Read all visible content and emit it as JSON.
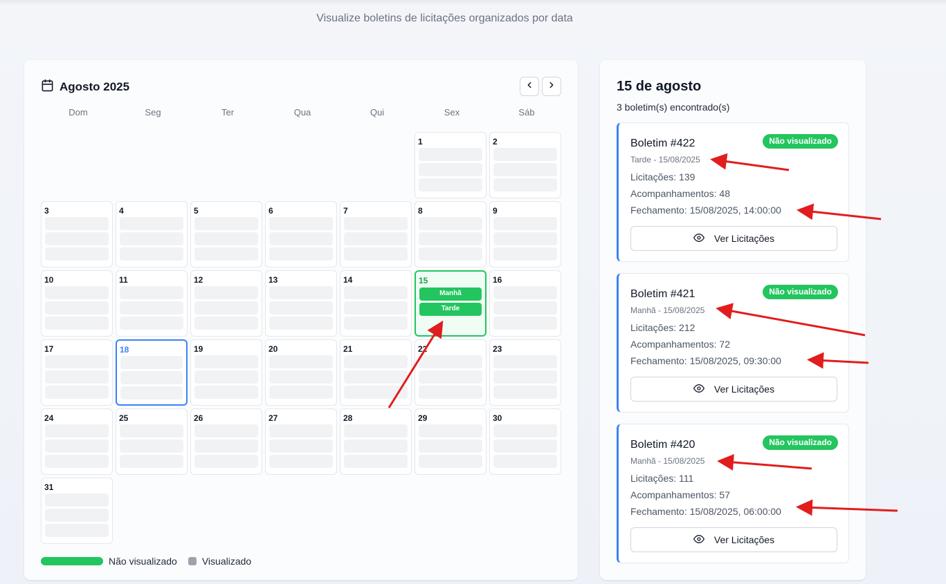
{
  "page": {
    "subtitle": "Visualize boletins de licitações organizados por data"
  },
  "calendar": {
    "month_label": "Agosto 2025",
    "icon": "calendar-icon",
    "prev_icon": "chevron-left-icon",
    "next_icon": "chevron-right-icon",
    "weekdays": [
      "Dom",
      "Seg",
      "Ter",
      "Qua",
      "Qui",
      "Sex",
      "Sáb"
    ],
    "days": [
      "1",
      "2",
      "3",
      "4",
      "5",
      "6",
      "7",
      "8",
      "9",
      "10",
      "11",
      "12",
      "13",
      "14",
      "15",
      "16",
      "17",
      "18",
      "19",
      "20",
      "21",
      "22",
      "23",
      "24",
      "25",
      "26",
      "27",
      "28",
      "29",
      "30",
      "31"
    ],
    "today": "18",
    "selected": "15",
    "selected_chips": [
      "Manhã",
      "Tarde"
    ],
    "legend": {
      "unviewed": "Não visualizado",
      "viewed": "Visualizado",
      "unviewed_color": "#22c55e",
      "viewed_color": "#9ca3af"
    }
  },
  "panel": {
    "title": "15 de agosto",
    "count": "3 boletim(s) encontrado(s)",
    "bulletins": [
      {
        "title": "Boletim #422",
        "badge": "Não visualizado",
        "subtitle": "Tarde - 15/08/2025",
        "licitacoes": "Licitações: 139",
        "acompanhamentos": "Acompanhamentos: 48",
        "fechamento": "Fechamento: 15/08/2025, 14:00:00",
        "button": "Ver Licitações"
      },
      {
        "title": "Boletim #421",
        "badge": "Não visualizado",
        "subtitle": "Manhã - 15/08/2025",
        "licitacoes": "Licitações: 212",
        "acompanhamentos": "Acompanhamentos: 72",
        "fechamento": "Fechamento: 15/08/2025, 09:30:00",
        "button": "Ver Licitações"
      },
      {
        "title": "Boletim #420",
        "badge": "Não visualizado",
        "subtitle": "Manhã - 15/08/2025",
        "licitacoes": "Licitações: 111",
        "acompanhamentos": "Acompanhamentos: 57",
        "fechamento": "Fechamento: 15/08/2025, 06:00:00",
        "button": "Ver Licitações"
      }
    ]
  },
  "colors": {
    "accent_blue": "#3b82f6",
    "accent_green": "#22c55e",
    "annotation_red": "#e11d1d"
  }
}
